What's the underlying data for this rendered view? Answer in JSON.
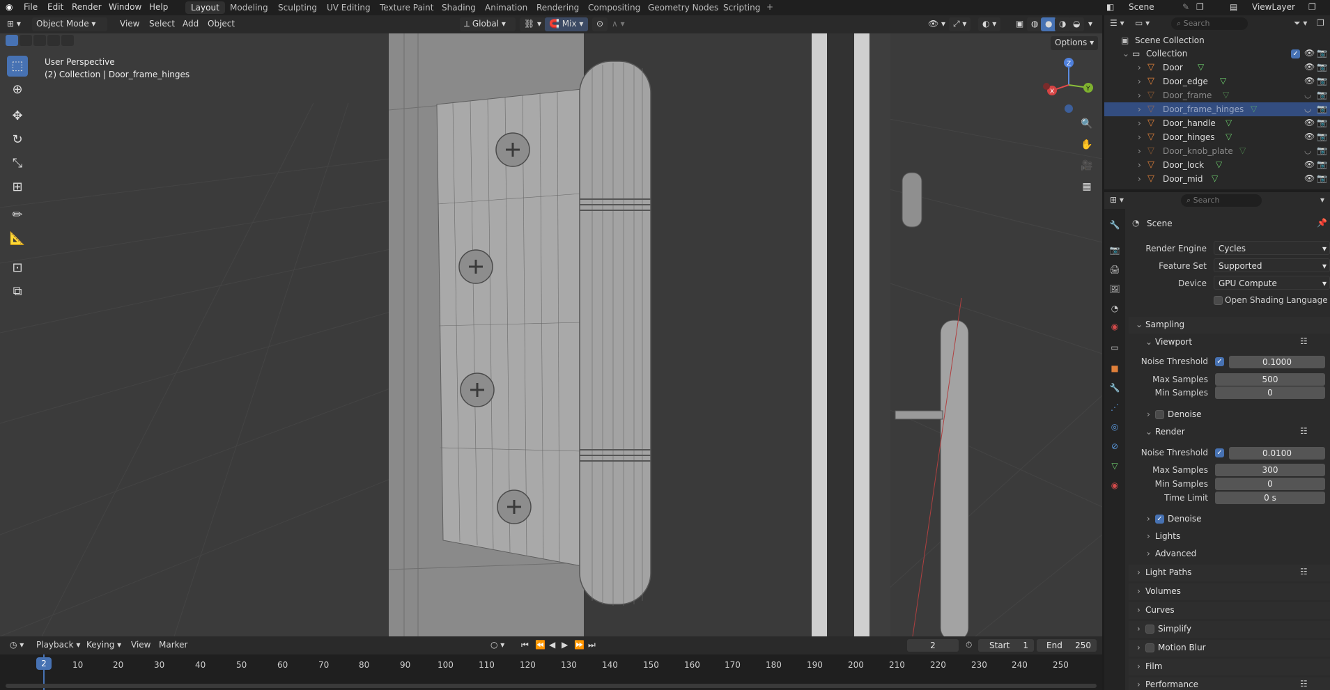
{
  "menubar": {
    "menus": [
      "File",
      "Edit",
      "Render",
      "Window",
      "Help"
    ],
    "workspaces": [
      "Layout",
      "Modeling",
      "Sculpting",
      "UV Editing",
      "Texture Paint",
      "Shading",
      "Animation",
      "Rendering",
      "Compositing",
      "Geometry Nodes",
      "Scripting"
    ],
    "active_workspace": "Layout",
    "scene_name": "Scene",
    "view_layer": "ViewLayer"
  },
  "header3d": {
    "mode": "Object Mode",
    "menus": [
      "View",
      "Select",
      "Add",
      "Object"
    ],
    "orientation": "Global",
    "snap": "Mix",
    "options": "Options"
  },
  "viewport": {
    "perspective_label": "User Perspective",
    "collection_label": "(2) Collection | Door_frame_hinges",
    "gizmo": {
      "x": "X",
      "y": "Y",
      "z": "Z"
    }
  },
  "outliner": {
    "search_placeholder": "Search",
    "root": "Scene Collection",
    "collection": "Collection",
    "items": [
      {
        "name": "Door",
        "visible": true,
        "selected": false
      },
      {
        "name": "Door_edge",
        "visible": true,
        "selected": false
      },
      {
        "name": "Door_frame",
        "visible": false,
        "selected": false
      },
      {
        "name": "Door_frame_hinges",
        "visible": false,
        "selected": true
      },
      {
        "name": "Door_handle",
        "visible": true,
        "selected": false
      },
      {
        "name": "Door_hinges",
        "visible": true,
        "selected": false
      },
      {
        "name": "Door_knob_plate",
        "visible": false,
        "selected": false
      },
      {
        "name": "Door_lock",
        "visible": true,
        "selected": false
      },
      {
        "name": "Door_mid",
        "visible": true,
        "selected": false
      }
    ]
  },
  "properties": {
    "search_placeholder": "Search",
    "context": "Scene",
    "render_engine_label": "Render Engine",
    "render_engine": "Cycles",
    "feature_set_label": "Feature Set",
    "feature_set": "Supported",
    "device_label": "Device",
    "device": "GPU Compute",
    "osl_label": "Open Shading Language",
    "sampling": "Sampling",
    "viewport_section": "Viewport",
    "vp_noise_label": "Noise Threshold",
    "vp_noise": "0.1000",
    "vp_max_label": "Max Samples",
    "vp_max": "500",
    "vp_min_label": "Min Samples",
    "vp_min": "0",
    "vp_denoise": "Denoise",
    "render_section": "Render",
    "r_noise_label": "Noise Threshold",
    "r_noise": "0.0100",
    "r_max_label": "Max Samples",
    "r_max": "300",
    "r_min_label": "Min Samples",
    "r_min": "0",
    "r_time_label": "Time Limit",
    "r_time": "0 s",
    "r_denoise": "Denoise",
    "lights": "Lights",
    "advanced": "Advanced",
    "light_paths": "Light Paths",
    "volumes": "Volumes",
    "curves": "Curves",
    "simplify": "Simplify",
    "motion_blur": "Motion Blur",
    "film": "Film",
    "performance": "Performance"
  },
  "timeline": {
    "menus": [
      "Playback",
      "Keying",
      "View",
      "Marker"
    ],
    "current_frame": "2",
    "start_label": "Start",
    "start": "1",
    "end_label": "End",
    "end": "250",
    "ticks": [
      "10",
      "20",
      "30",
      "40",
      "50",
      "60",
      "70",
      "80",
      "90",
      "100",
      "110",
      "120",
      "130",
      "140",
      "150",
      "160",
      "170",
      "180",
      "190",
      "200",
      "210",
      "220",
      "230",
      "240",
      "250"
    ],
    "playhead_label": "2"
  }
}
